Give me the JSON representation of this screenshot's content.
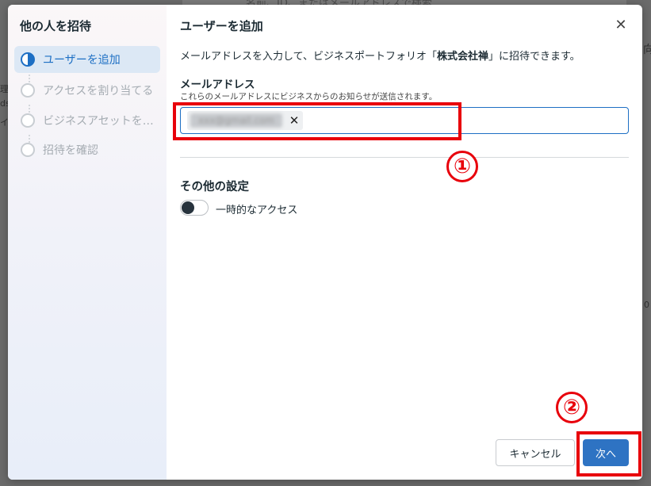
{
  "background": {
    "search_fragment": "名前、ID、またはメールアドレスで検索",
    "left_fragments": [
      "理",
      "ds",
      "イ"
    ],
    "right_fragments": [
      "向",
      "0"
    ]
  },
  "modal": {
    "sidebar": {
      "title": "他の人を招待",
      "steps": [
        {
          "label": "ユーザーを追加",
          "active": true
        },
        {
          "label": "アクセスを割り当てる",
          "active": false
        },
        {
          "label": "ビジネスアセットを追加",
          "active": false
        },
        {
          "label": "招待を確認",
          "active": false
        }
      ]
    },
    "title": "ユーザーを追加",
    "description_before": "メールアドレスを入力して、ビジネスポートフォリオ「",
    "business_name": "株式会社禅",
    "description_after": "」に招待できます。",
    "email_label": "メールアドレス",
    "email_sublabel": "これらのメールアドレスにビジネスからのお知らせが送信されます。",
    "email_chip": "xxx@gmail.com",
    "chip_remove": "✕",
    "other_settings_title": "その他の設定",
    "temporary_access_label": "一時的なアクセス",
    "temporary_access_on": false,
    "close_glyph": "✕",
    "cancel_label": "キャンセル",
    "next_label": "次へ"
  },
  "annotations": {
    "one": "①",
    "two": "②",
    "color": "#e8000b"
  },
  "colors": {
    "accent": "#1d6fc4",
    "primary_button": "#2e73c3",
    "active_step_bg": "#dce8f5"
  }
}
